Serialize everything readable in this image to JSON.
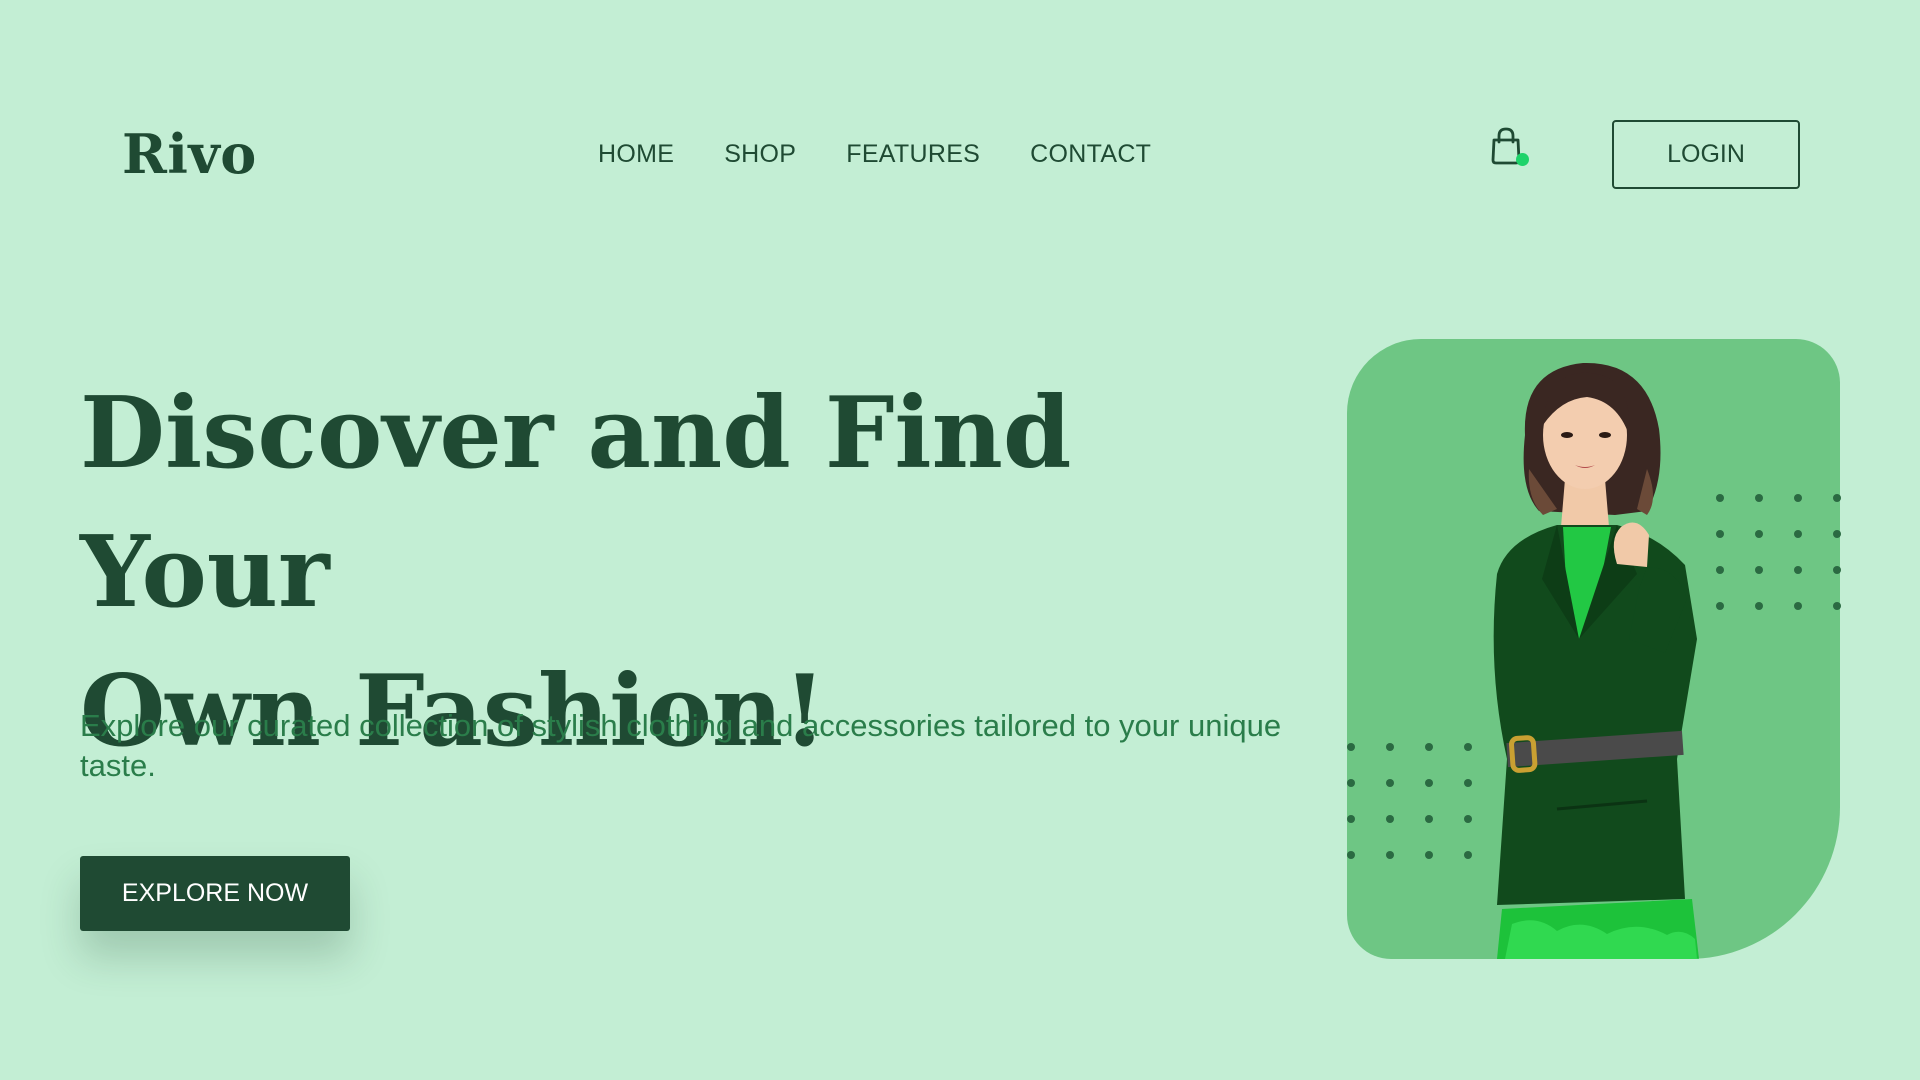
{
  "brand": {
    "logo": "Rivo"
  },
  "nav": {
    "items": [
      {
        "label": "HOME"
      },
      {
        "label": "SHOP"
      },
      {
        "label": "FEATURES"
      },
      {
        "label": "CONTACT"
      }
    ]
  },
  "header": {
    "cart_icon": "shopping-bag-icon",
    "login_label": "LOGIN"
  },
  "hero": {
    "title_line1": "Discover and Find Your",
    "title_line2": "Own Fashion!",
    "subtitle": "Explore our curated collection of stylish clothing and accessories tailored to your unique taste.",
    "cta_label": "EXPLORE NOW"
  },
  "colors": {
    "background": "#c3eed4",
    "primary": "#1f4a33",
    "subtitle": "#2a7d4a",
    "card": "#6ec684",
    "cart_badge": "#1ed36a"
  }
}
